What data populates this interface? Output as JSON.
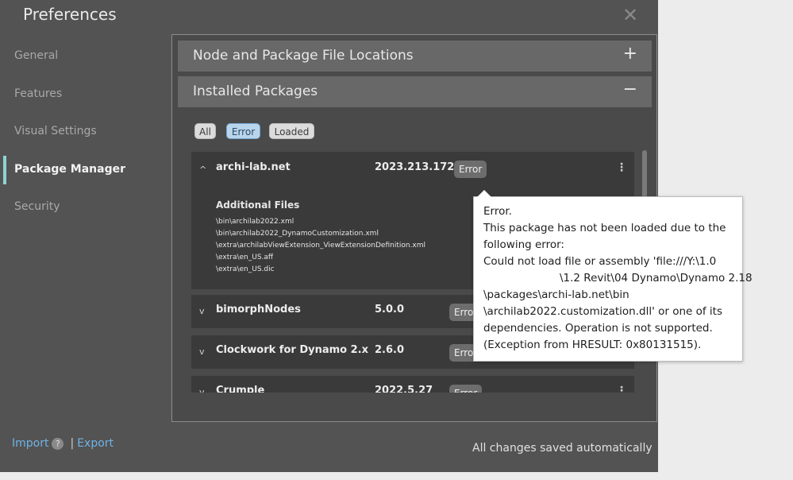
{
  "window": {
    "title": "Preferences"
  },
  "nav": {
    "items": [
      {
        "label": "General"
      },
      {
        "label": "Features"
      },
      {
        "label": "Visual Settings"
      },
      {
        "label": "Package Manager"
      },
      {
        "label": "Security"
      }
    ],
    "active": "Package Manager"
  },
  "sections": {
    "locations": {
      "label": "Node and Package File Locations",
      "toggle": "+"
    },
    "installed": {
      "label": "Installed Packages",
      "toggle": "−"
    }
  },
  "filters": [
    {
      "label": "All",
      "active": false
    },
    {
      "label": "Error",
      "active": true
    },
    {
      "label": "Loaded",
      "active": false
    }
  ],
  "packages": [
    {
      "name": "archi-lab.net",
      "version": "2023.213.1722",
      "status": "Error",
      "expanded": true,
      "files_title": "Additional Files",
      "files": [
        "\\bin\\archilab2022.xml",
        "\\bin\\archilab2022_DynamoCustomization.xml",
        "\\extra\\archilabViewExtension_ViewExtensionDefinition.xml",
        "\\extra\\en_US.aff",
        "\\extra\\en_US.dic"
      ]
    },
    {
      "name": "bimorphNodes",
      "version": "5.0.0",
      "status": "Error",
      "expanded": false
    },
    {
      "name": "Clockwork for Dynamo 2.x",
      "version": "2.6.0",
      "status": "Error",
      "expanded": false
    },
    {
      "name": "Crumple",
      "version": "2022.5.27",
      "status": "Error",
      "expanded": false
    }
  ],
  "tooltip": {
    "lines": [
      "Error.",
      "This package has not been loaded due to the",
      "following error:",
      "Could not load file or assembly 'file:///Y:\\1.0",
      "\\1.2 Revit\\04 Dynamo\\Dynamo 2.18",
      "\\packages\\archi-lab.net\\bin",
      "\\archilab2022.customization.dll' or one of its",
      "dependencies. Operation is not supported.",
      "(Exception from HRESULT: 0x80131515)."
    ]
  },
  "footer": {
    "import_label": "Import",
    "help_glyph": "?",
    "separator": "|",
    "export_label": "Export",
    "status": "All changes saved automatically"
  },
  "colors": {
    "accent": "#8fd3d3",
    "link": "#6fb3e6",
    "error_filter": "#b8d5ec"
  }
}
